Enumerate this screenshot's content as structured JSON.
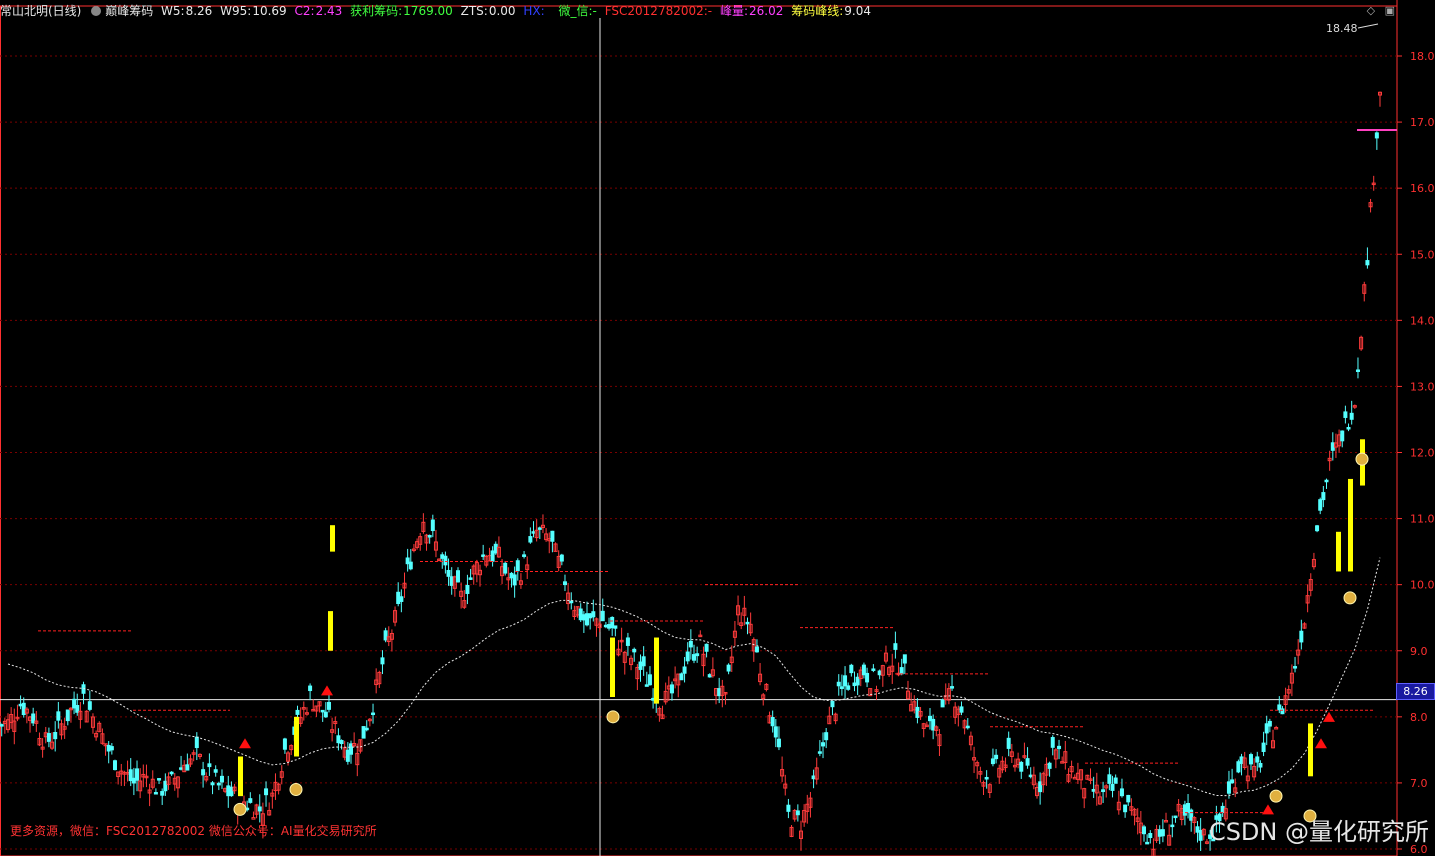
{
  "header": {
    "stock": "常山北明(日线)",
    "indicator": "巅峰筹码",
    "w5_label": "W5:",
    "w5": "8.26",
    "w95_label": "W95:",
    "w95": "10.69",
    "c2_label": "C2:",
    "c2": "2.43",
    "profit_label": "获利筹码:",
    "profit": "1769.00",
    "zts_label": "ZTS:",
    "zts": "0.00",
    "hx_label": "HX:",
    "wechat_label": "微_信:-",
    "wechat_id": "FSC2012782002:-",
    "peak_label": "峰量:",
    "peak": "26.02",
    "chip_label": "筹码峰线:",
    "chip": "9.04"
  },
  "window_controls": {
    "diamond_icon": "◇",
    "restore_icon": "▣"
  },
  "footer_note": "更多资源，微信：FSC2012782002 微信公众号：AI量化交易研究所",
  "watermark": "CSDN @量化研究所",
  "current_price_label": "8.26",
  "max_price_label": "18.48",
  "colors": {
    "up": "#ff3b3b",
    "down": "#54ffff",
    "highlight": "#ffff00",
    "grid": "#7a0000",
    "axis": "#ff3030"
  },
  "chart_data": {
    "type": "candlestick",
    "y_axis_ticks": [
      "18.0",
      "17.0",
      "16.0",
      "15.0",
      "14.0",
      "13.0",
      "12.0",
      "11.0",
      "10.0",
      "9.0",
      "8.0",
      "7.0",
      "6.0"
    ],
    "ylim": [
      5.9,
      18.6
    ],
    "current_price": 8.26,
    "max_price": 18.48,
    "close_series": [
      7.9,
      8.2,
      8.0,
      7.6,
      7.8,
      8.1,
      8.3,
      7.9,
      7.5,
      7.2,
      7.0,
      7.1,
      6.9,
      7.0,
      7.3,
      7.4,
      7.1,
      6.9,
      6.8,
      6.7,
      6.6,
      6.8,
      7.5,
      7.9,
      8.3,
      8.1,
      7.8,
      7.5,
      7.6,
      8.2,
      9.0,
      9.6,
      10.4,
      11.0,
      10.6,
      10.1,
      9.8,
      10.2,
      10.5,
      10.4,
      10.0,
      10.3,
      10.8,
      10.7,
      10.2,
      9.7,
      9.4,
      9.5,
      9.3,
      9.0,
      8.8,
      8.5,
      8.2,
      8.4,
      8.9,
      9.1,
      8.6,
      8.2,
      9.6,
      9.4,
      8.5,
      7.8,
      6.5,
      6.4,
      6.9,
      7.8,
      8.3,
      8.6,
      8.7,
      8.5,
      8.9,
      8.8,
      8.2,
      7.8,
      7.9,
      8.4,
      8.0,
      7.2,
      7.1,
      7.3,
      7.4,
      7.2,
      7.0,
      7.5,
      7.3,
      7.1,
      6.9,
      6.8,
      6.9,
      6.6,
      6.4,
      6.1,
      6.3,
      6.5,
      6.4,
      6.2,
      6.3,
      6.8,
      7.4,
      7.1,
      7.6,
      8.0,
      8.6,
      9.5,
      10.9,
      11.8,
      12.3,
      12.8,
      15.0,
      17.5
    ]
  }
}
